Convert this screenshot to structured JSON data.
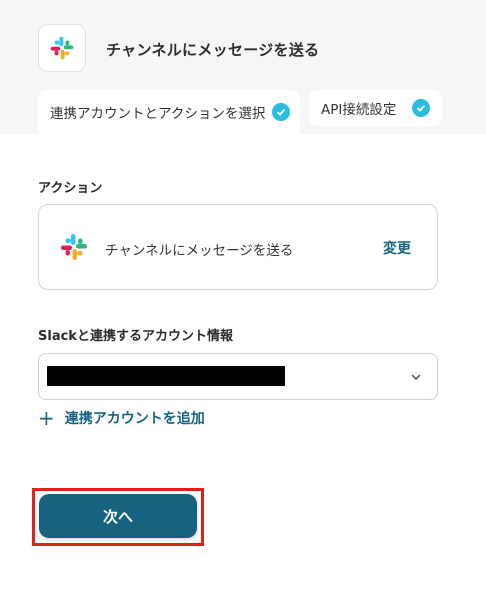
{
  "header": {
    "title": "チャンネルにメッセージを送る",
    "app_icon": "slack-logo"
  },
  "tabs": [
    {
      "label": "連携アカウントとアクションを選択",
      "completed": true,
      "active": true
    },
    {
      "label": "API接続設定",
      "completed": true,
      "active": false
    }
  ],
  "action_section": {
    "label": "アクション",
    "action_name": "チャンネルにメッセージを送る",
    "change_label": "変更"
  },
  "account_section": {
    "label": "Slackと連携するアカウント情報",
    "selected_value": "",
    "add_label": "連携アカウントを追加"
  },
  "footer": {
    "next_label": "次へ"
  },
  "colors": {
    "accent": "#16627f",
    "check": "#29bde0",
    "highlight": "#e0201c"
  }
}
